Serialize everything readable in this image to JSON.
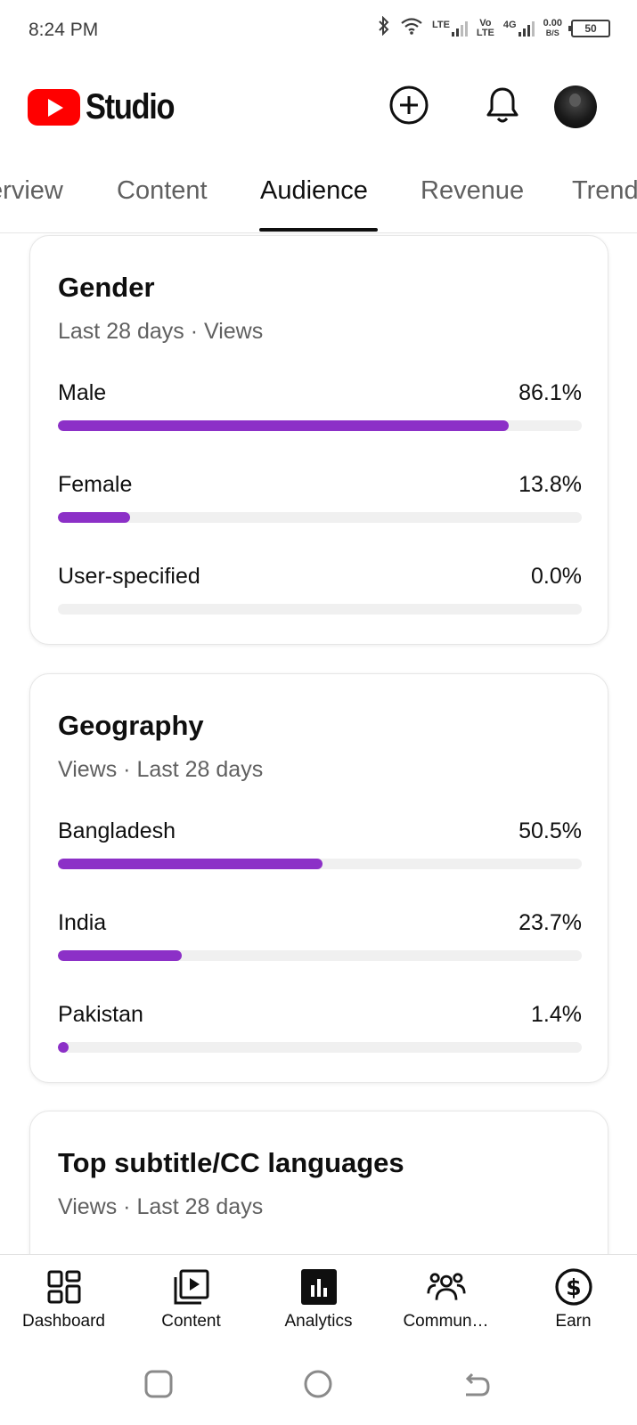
{
  "status_bar": {
    "time": "8:24 PM",
    "net1": "LTE",
    "net2_top": "Vo",
    "net2_bottom": "LTE",
    "net3": "4G",
    "speed_value": "0.00",
    "speed_unit": "B/S",
    "battery": "50"
  },
  "header": {
    "logo_text": "Studio",
    "icons": [
      "create-icon",
      "notifications-icon",
      "avatar"
    ]
  },
  "tabs": [
    {
      "label": "Overview",
      "active": false
    },
    {
      "label": "Content",
      "active": false
    },
    {
      "label": "Audience",
      "active": true
    },
    {
      "label": "Revenue",
      "active": false
    },
    {
      "label": "Trends",
      "active": false
    }
  ],
  "gender_card": {
    "title": "Gender",
    "subtitle": "Last 28 days · Views",
    "rows": [
      {
        "label": "Male",
        "value": "86.1%",
        "percent": 86.1
      },
      {
        "label": "Female",
        "value": "13.8%",
        "percent": 13.8
      },
      {
        "label": "User-specified",
        "value": "0.0%",
        "percent": 0.0
      }
    ]
  },
  "geography_card": {
    "title": "Geography",
    "subtitle": "Views · Last 28 days",
    "rows": [
      {
        "label": "Bangladesh",
        "value": "50.5%",
        "percent": 50.5
      },
      {
        "label": "India",
        "value": "23.7%",
        "percent": 23.7
      },
      {
        "label": "Pakistan",
        "value": "1.4%",
        "percent": 1.4
      }
    ]
  },
  "subtitle_card": {
    "title": "Top subtitle/CC languages",
    "subtitle": "Views · Last 28 days"
  },
  "bottom_nav": [
    {
      "label": "Dashboard",
      "icon": "dashboard-icon",
      "active": false
    },
    {
      "label": "Content",
      "icon": "content-icon",
      "active": false
    },
    {
      "label": "Analytics",
      "icon": "analytics-icon",
      "active": true
    },
    {
      "label": "Commun…",
      "icon": "community-icon",
      "active": false
    },
    {
      "label": "Earn",
      "icon": "earn-icon",
      "active": false
    }
  ],
  "colors": {
    "accent_bar": "#8c30c7",
    "brand_red": "#ff0000",
    "track": "#f0f0f0"
  }
}
